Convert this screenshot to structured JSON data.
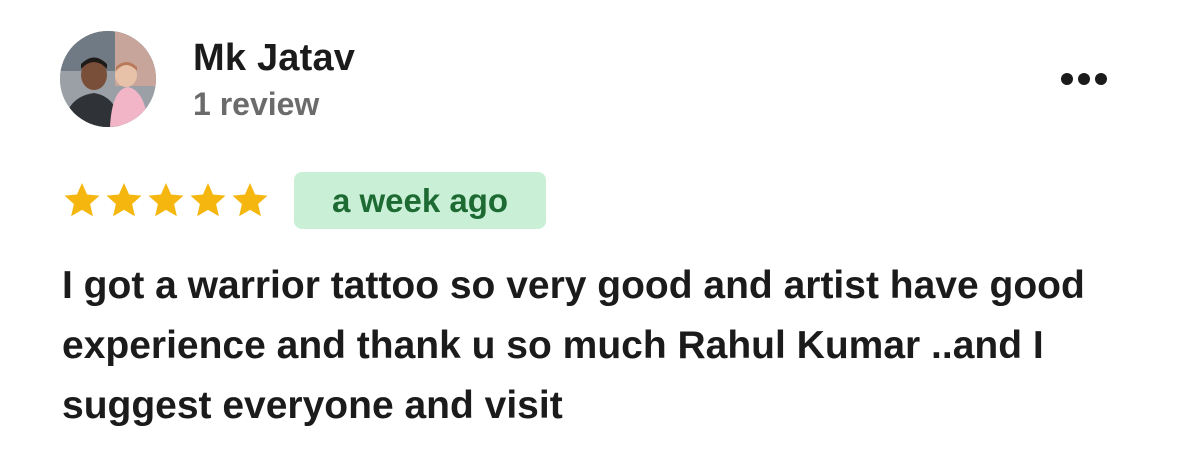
{
  "review": {
    "author": {
      "name": "Mk Jatav",
      "review_count": "1 review",
      "avatar_icon": "user-photo-avatar"
    },
    "more_icon": "more-horizontal-icon",
    "rating": {
      "stars": 5,
      "max": 5,
      "star_color": "#f5b70f"
    },
    "time_label": "a week ago",
    "badge_bg": "#c9f0d6",
    "badge_text_color": "#1d6b33",
    "text": "I got a warrior tattoo so very good and artist have good experience and thank u so much Rahul Kumar ..and I suggest everyone and visit"
  }
}
